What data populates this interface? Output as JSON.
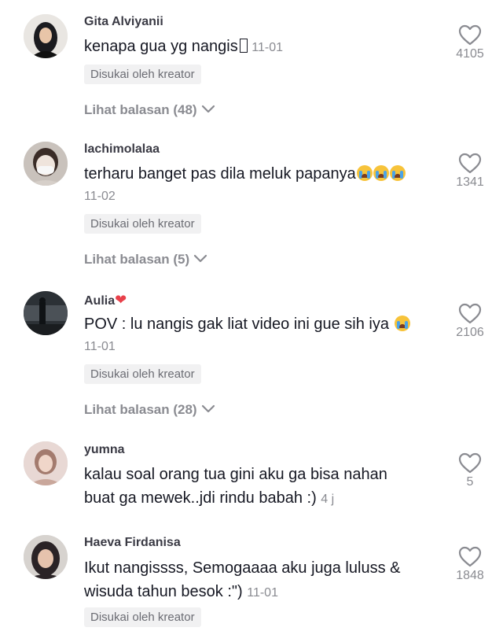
{
  "comments": [
    {
      "username": "Gita Alviyanii",
      "text": "kenapa gua yg nangis",
      "date": "11-01",
      "badge": "Disukai oleh kreator",
      "replies": "Lihat balasan (48)",
      "likes": "4105"
    },
    {
      "username": "lachimolalaa",
      "text": "terharu banget pas dila meluk papanya",
      "date": "11-02",
      "badge": "Disukai oleh kreator",
      "replies": "Lihat balasan (5)",
      "likes": "1341"
    },
    {
      "username": "Aulia",
      "text": "POV : lu nangis gak liat video ini gue sih iya",
      "date": "11-01",
      "badge": "Disukai oleh kreator",
      "replies": "Lihat balasan (28)",
      "likes": "2106"
    },
    {
      "username": "yumna",
      "text_line1": "kalau soal orang tua gini aku ga bisa nahan",
      "text_line2": "buat ga mewek..jdi rindu babah :)",
      "date": "4 j",
      "likes": "5"
    },
    {
      "username": "Haeva Firdanisa",
      "text_line1": "Ikut nangissss, Semogaaaa aku juga luluss &",
      "text_line2": "wisuda tahun besok :\")",
      "date": "11-01",
      "badge": "Disukai oleh kreator",
      "likes": "1848"
    }
  ],
  "icons": {
    "like": "heart-outline-icon",
    "expand": "chevron-down-icon",
    "crying_emoji": "loudly-crying-face-emoji",
    "red_heart": "red-heart-emoji"
  }
}
